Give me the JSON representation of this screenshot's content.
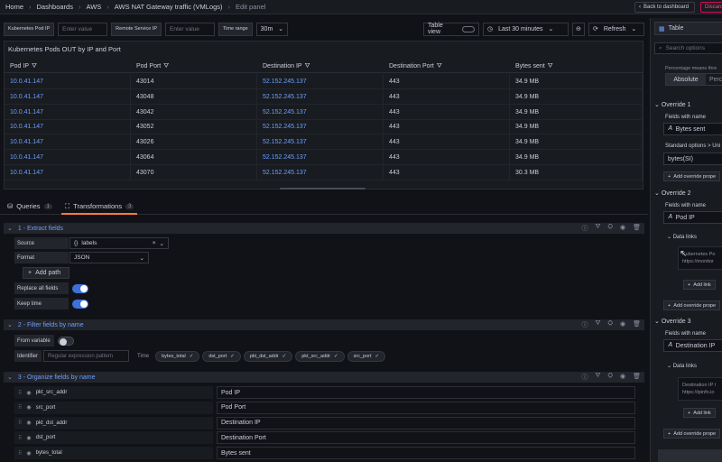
{
  "breadcrumb": [
    "Home",
    "Dashboards",
    "AWS",
    "AWS NAT Gateway traffic (VMLogs)",
    "Edit panel"
  ],
  "topbar": {
    "back_label": "Back to dashboard",
    "discard_label": "Discard"
  },
  "variables": {
    "pod_ip_label": "Kubernetes Pod IP",
    "pod_ip_placeholder": "Enter value",
    "remote_label": "Remote Service IP",
    "remote_placeholder": "Enter value",
    "time_range_label": "Time range",
    "time_range_value": "30m"
  },
  "controls": {
    "table_view": "Table view",
    "time_picker": "Last 30 minutes",
    "refresh": "Refresh"
  },
  "panel": {
    "title": "Kubernetes Pods OUT by IP and Port",
    "columns": [
      "Pod IP",
      "Pod Port",
      "Destination IP",
      "Destination Port",
      "Bytes sent"
    ],
    "rows": [
      [
        "10.0.41.147",
        "43014",
        "52.152.245.137",
        "443",
        "34.9 MB"
      ],
      [
        "10.0.41.147",
        "43048",
        "52.152.245.137",
        "443",
        "34.9 MB"
      ],
      [
        "10.0.41.147",
        "43042",
        "52.152.245.137",
        "443",
        "34.9 MB"
      ],
      [
        "10.0.41.147",
        "43052",
        "52.152.245.137",
        "443",
        "34.9 MB"
      ],
      [
        "10.0.41.147",
        "43026",
        "52.152.245.137",
        "443",
        "34.9 MB"
      ],
      [
        "10.0.41.147",
        "43064",
        "52.152.245.137",
        "443",
        "34.9 MB"
      ],
      [
        "10.0.41.147",
        "43070",
        "52.152.245.137",
        "443",
        "30.3 MB"
      ]
    ]
  },
  "tabs": {
    "queries": "Queries",
    "queries_count": "1",
    "transformations": "Transformations",
    "transformations_count": "3"
  },
  "t1": {
    "title": "1 - Extract fields",
    "source_label": "Source",
    "source_value": "labels",
    "format_label": "Format",
    "format_value": "JSON",
    "add_path": "Add path",
    "replace_label": "Replace all fields",
    "keep_time_label": "Keep time"
  },
  "t2": {
    "title": "2 - Filter fields by name",
    "from_variable": "From variable",
    "identifier": "Identifier",
    "identifier_placeholder": "Regular expression pattern",
    "time_label": "Time",
    "chips": [
      "bytes_total",
      "dst_port",
      "pkt_dst_addr",
      "pkt_src_addr",
      "src_port"
    ]
  },
  "t3": {
    "title": "3 - Organize fields by name",
    "fields": [
      {
        "name": "pkt_src_addr",
        "rename": "Pod IP"
      },
      {
        "name": "src_port",
        "rename": "Pod Port"
      },
      {
        "name": "pkt_dst_addr",
        "rename": "Destination IP"
      },
      {
        "name": "dst_port",
        "rename": "Destination Port"
      },
      {
        "name": "bytes_total",
        "rename": "Bytes sent"
      }
    ]
  },
  "sidebar": {
    "viz": "Table",
    "search_placeholder": "Search options",
    "hint": "Percentage means thre",
    "mode_absolute": "Absolute",
    "mode_percent": "Perc",
    "o1_title": "Override 1",
    "fields_with_name": "Fields with name",
    "o1_field": "Bytes sent",
    "o1_prop": "Standard options > Uni",
    "o1_value": "bytes(SI)",
    "add_prop": "Add override prope",
    "o2_title": "Override 2",
    "o2_field": "Pod IP",
    "data_links": "Data links",
    "o2_link_title": "Kubernetes Po",
    "o2_link_url": "https://monitor",
    "add_link": "Add link",
    "o3_title": "Override 3",
    "o3_field": "Destination IP",
    "o3_link_title": "Destination IP l",
    "o3_link_url": "https://ipinfo.io"
  }
}
